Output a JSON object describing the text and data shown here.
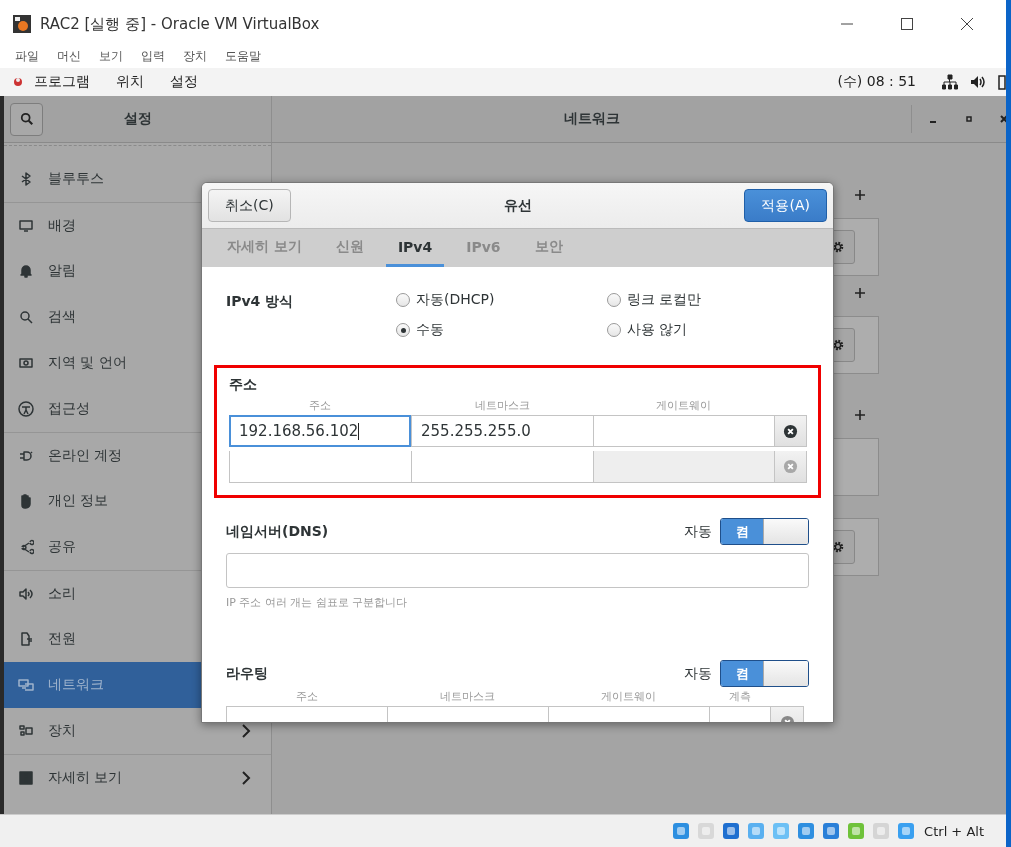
{
  "window": {
    "title": "RAC2 [실행 중] - Oracle VM VirtualBox"
  },
  "menu": [
    "파일",
    "머신",
    "보기",
    "입력",
    "장치",
    "도움말"
  ],
  "guest_top_bar": {
    "menus": [
      "프로그램",
      "위치",
      "설정"
    ],
    "clock": "(수) 08 : 51"
  },
  "settings": {
    "title": "설정",
    "panel_title": "네트워크",
    "sidebar": [
      {
        "label": "블루투스",
        "selected": false,
        "separator_before": false
      },
      {
        "label": "배경",
        "selected": false,
        "separator_before": true
      },
      {
        "label": "알림",
        "selected": false,
        "separator_before": false
      },
      {
        "label": "검색",
        "selected": false,
        "separator_before": false
      },
      {
        "label": "지역 및 언어",
        "selected": false,
        "separator_before": false
      },
      {
        "label": "접근성",
        "selected": false,
        "separator_before": false
      },
      {
        "label": "온라인 계정",
        "selected": false,
        "separator_before": true
      },
      {
        "label": "개인 정보",
        "selected": false,
        "separator_before": false
      },
      {
        "label": "공유",
        "selected": false,
        "separator_before": false
      },
      {
        "label": "소리",
        "selected": false,
        "separator_before": true
      },
      {
        "label": "전원",
        "selected": false,
        "separator_before": false
      },
      {
        "label": "네트워크",
        "selected": true,
        "separator_before": false
      },
      {
        "label": "장치",
        "selected": false,
        "separator_before": false,
        "submenu": true
      },
      {
        "label": "자세히 보기",
        "selected": false,
        "separator_before": true,
        "submenu": true
      }
    ]
  },
  "dialog": {
    "cancel": "취소(C)",
    "title": "유선",
    "apply": "적용(A)",
    "tabs": [
      {
        "label": "자세히 보기",
        "selected": false
      },
      {
        "label": "신원",
        "selected": false
      },
      {
        "label": "IPv4",
        "selected": true
      },
      {
        "label": "IPv6",
        "selected": false
      },
      {
        "label": "보안",
        "selected": false
      }
    ],
    "method": {
      "label": "IPv4 방식",
      "options": [
        {
          "label": "자동(DHCP)",
          "selected": false
        },
        {
          "label": "링크 로컬만",
          "selected": false
        },
        {
          "label": "수동",
          "selected": true
        },
        {
          "label": "사용 않기",
          "selected": false
        }
      ]
    },
    "addresses": {
      "title": "주소",
      "highlighted": true,
      "columns": [
        "주소",
        "네트마스크",
        "게이트웨이"
      ],
      "rows": [
        {
          "cells": [
            "192.168.56.102",
            "255.255.255.0"
          ],
          "focused": true,
          "blank": false
        },
        {
          "focused": false,
          "blank": true
        }
      ]
    },
    "dns": {
      "title": "네임서버(DNS)",
      "auto_label": "자동",
      "switch": {
        "label": "켬",
        "on": true
      },
      "hint": "IP 주소 여러 개는 쉼표로 구분합니다"
    },
    "routes": {
      "title": "라우팅",
      "auto_label": "자동",
      "switch": {
        "label": "켬",
        "on": true
      },
      "columns": [
        "주소",
        "네트마스크",
        "게이트웨이",
        "계측"
      ]
    }
  },
  "status_bar": {
    "host_key": "Ctrl + Alt"
  }
}
